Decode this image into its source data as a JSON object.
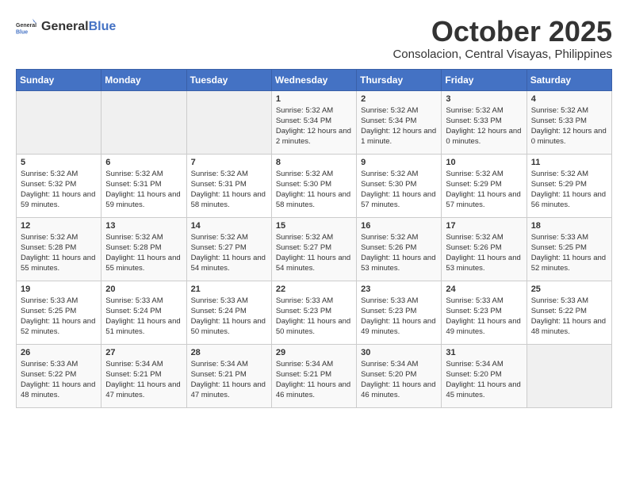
{
  "header": {
    "logo_general": "General",
    "logo_blue": "Blue",
    "month_title": "October 2025",
    "subtitle": "Consolacion, Central Visayas, Philippines"
  },
  "days_of_week": [
    "Sunday",
    "Monday",
    "Tuesday",
    "Wednesday",
    "Thursday",
    "Friday",
    "Saturday"
  ],
  "weeks": [
    [
      {
        "day": "",
        "info": ""
      },
      {
        "day": "",
        "info": ""
      },
      {
        "day": "",
        "info": ""
      },
      {
        "day": "1",
        "info": "Sunrise: 5:32 AM\nSunset: 5:34 PM\nDaylight: 12 hours\nand 2 minutes."
      },
      {
        "day": "2",
        "info": "Sunrise: 5:32 AM\nSunset: 5:34 PM\nDaylight: 12 hours\nand 1 minute."
      },
      {
        "day": "3",
        "info": "Sunrise: 5:32 AM\nSunset: 5:33 PM\nDaylight: 12 hours\nand 0 minutes."
      },
      {
        "day": "4",
        "info": "Sunrise: 5:32 AM\nSunset: 5:33 PM\nDaylight: 12 hours\nand 0 minutes."
      }
    ],
    [
      {
        "day": "5",
        "info": "Sunrise: 5:32 AM\nSunset: 5:32 PM\nDaylight: 11 hours\nand 59 minutes."
      },
      {
        "day": "6",
        "info": "Sunrise: 5:32 AM\nSunset: 5:31 PM\nDaylight: 11 hours\nand 59 minutes."
      },
      {
        "day": "7",
        "info": "Sunrise: 5:32 AM\nSunset: 5:31 PM\nDaylight: 11 hours\nand 58 minutes."
      },
      {
        "day": "8",
        "info": "Sunrise: 5:32 AM\nSunset: 5:30 PM\nDaylight: 11 hours\nand 58 minutes."
      },
      {
        "day": "9",
        "info": "Sunrise: 5:32 AM\nSunset: 5:30 PM\nDaylight: 11 hours\nand 57 minutes."
      },
      {
        "day": "10",
        "info": "Sunrise: 5:32 AM\nSunset: 5:29 PM\nDaylight: 11 hours\nand 57 minutes."
      },
      {
        "day": "11",
        "info": "Sunrise: 5:32 AM\nSunset: 5:29 PM\nDaylight: 11 hours\nand 56 minutes."
      }
    ],
    [
      {
        "day": "12",
        "info": "Sunrise: 5:32 AM\nSunset: 5:28 PM\nDaylight: 11 hours\nand 55 minutes."
      },
      {
        "day": "13",
        "info": "Sunrise: 5:32 AM\nSunset: 5:28 PM\nDaylight: 11 hours\nand 55 minutes."
      },
      {
        "day": "14",
        "info": "Sunrise: 5:32 AM\nSunset: 5:27 PM\nDaylight: 11 hours\nand 54 minutes."
      },
      {
        "day": "15",
        "info": "Sunrise: 5:32 AM\nSunset: 5:27 PM\nDaylight: 11 hours\nand 54 minutes."
      },
      {
        "day": "16",
        "info": "Sunrise: 5:32 AM\nSunset: 5:26 PM\nDaylight: 11 hours\nand 53 minutes."
      },
      {
        "day": "17",
        "info": "Sunrise: 5:32 AM\nSunset: 5:26 PM\nDaylight: 11 hours\nand 53 minutes."
      },
      {
        "day": "18",
        "info": "Sunrise: 5:33 AM\nSunset: 5:25 PM\nDaylight: 11 hours\nand 52 minutes."
      }
    ],
    [
      {
        "day": "19",
        "info": "Sunrise: 5:33 AM\nSunset: 5:25 PM\nDaylight: 11 hours\nand 52 minutes."
      },
      {
        "day": "20",
        "info": "Sunrise: 5:33 AM\nSunset: 5:24 PM\nDaylight: 11 hours\nand 51 minutes."
      },
      {
        "day": "21",
        "info": "Sunrise: 5:33 AM\nSunset: 5:24 PM\nDaylight: 11 hours\nand 50 minutes."
      },
      {
        "day": "22",
        "info": "Sunrise: 5:33 AM\nSunset: 5:23 PM\nDaylight: 11 hours\nand 50 minutes."
      },
      {
        "day": "23",
        "info": "Sunrise: 5:33 AM\nSunset: 5:23 PM\nDaylight: 11 hours\nand 49 minutes."
      },
      {
        "day": "24",
        "info": "Sunrise: 5:33 AM\nSunset: 5:23 PM\nDaylight: 11 hours\nand 49 minutes."
      },
      {
        "day": "25",
        "info": "Sunrise: 5:33 AM\nSunset: 5:22 PM\nDaylight: 11 hours\nand 48 minutes."
      }
    ],
    [
      {
        "day": "26",
        "info": "Sunrise: 5:33 AM\nSunset: 5:22 PM\nDaylight: 11 hours\nand 48 minutes."
      },
      {
        "day": "27",
        "info": "Sunrise: 5:34 AM\nSunset: 5:21 PM\nDaylight: 11 hours\nand 47 minutes."
      },
      {
        "day": "28",
        "info": "Sunrise: 5:34 AM\nSunset: 5:21 PM\nDaylight: 11 hours\nand 47 minutes."
      },
      {
        "day": "29",
        "info": "Sunrise: 5:34 AM\nSunset: 5:21 PM\nDaylight: 11 hours\nand 46 minutes."
      },
      {
        "day": "30",
        "info": "Sunrise: 5:34 AM\nSunset: 5:20 PM\nDaylight: 11 hours\nand 46 minutes."
      },
      {
        "day": "31",
        "info": "Sunrise: 5:34 AM\nSunset: 5:20 PM\nDaylight: 11 hours\nand 45 minutes."
      },
      {
        "day": "",
        "info": ""
      }
    ]
  ]
}
